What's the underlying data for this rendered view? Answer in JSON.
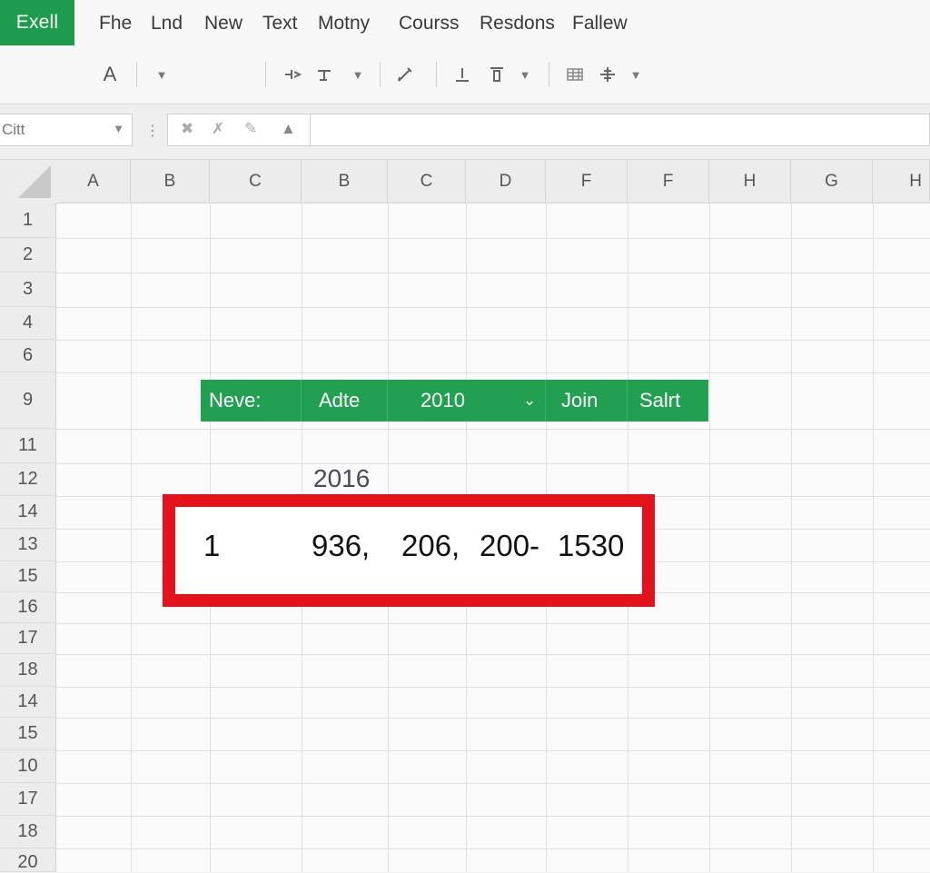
{
  "app": {
    "logo": "Exell"
  },
  "menu": [
    "Fhe",
    "Lnd",
    "New",
    "Text",
    "Motny",
    "Courss",
    "Resdons",
    "Fallew"
  ],
  "toolbar": {
    "font_glyph": "A"
  },
  "formula_bar": {
    "name_box": "Citt",
    "formula_value": ""
  },
  "columns": [
    "A",
    "B",
    "C",
    "B",
    "C",
    "D",
    "F",
    "F",
    "H",
    "G",
    "H"
  ],
  "rows": [
    "1",
    "2",
    "3",
    "4",
    "6",
    "9",
    "11",
    "12",
    "14",
    "13",
    "15",
    "16",
    "17",
    "18",
    "14",
    "15",
    "10",
    "17",
    "18",
    "20"
  ],
  "table_header": {
    "cells": [
      "Neve:",
      "Adte",
      "2010",
      "Join",
      "Salrt"
    ]
  },
  "label_above": "2016",
  "highlight_row": {
    "values": [
      "1",
      "936,",
      "206,",
      "200-",
      "1530"
    ]
  },
  "colors": {
    "brand_green": "#1e9c4d",
    "header_green": "#22a052",
    "highlight_red": "#e4121b"
  }
}
